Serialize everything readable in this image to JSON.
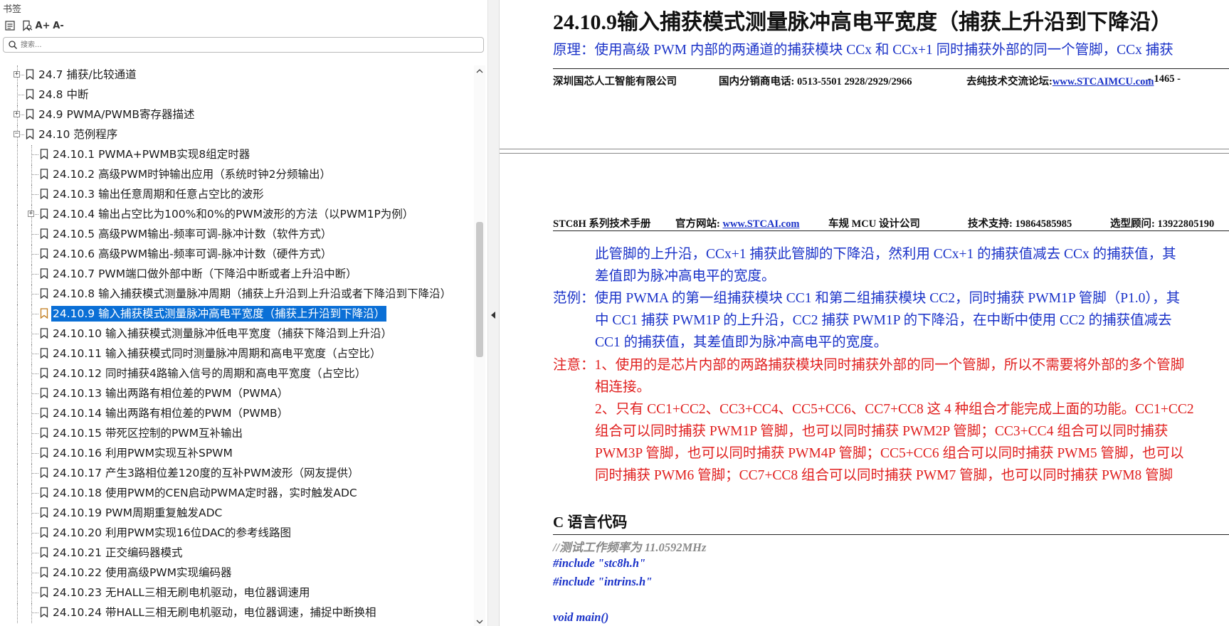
{
  "sidebar": {
    "title": "书签",
    "toolbar": {
      "btn1_icon": "list-icon",
      "btn2_icon": "bookmark-search-icon",
      "btn3_label": "A+",
      "btn4_label": "A-"
    },
    "search": {
      "placeholder": "搜索..."
    },
    "items": [
      {
        "label": "24.7 捕获/比较通道",
        "level": 1,
        "expandable": true,
        "expanded": false
      },
      {
        "label": "24.8 中断",
        "level": 1,
        "expandable": false
      },
      {
        "label": "24.9  PWMA/PWMB寄存器描述",
        "level": 1,
        "expandable": true,
        "expanded": false
      },
      {
        "label": "24.10  范例程序",
        "level": 1,
        "expandable": true,
        "expanded": true
      },
      {
        "label": "24.10.1 PWMA+PWMB实现8组定时器",
        "level": 2
      },
      {
        "label": "24.10.2 高级PWM时钟输出应用（系统时钟2分频输出）",
        "level": 2
      },
      {
        "label": "24.10.3 输出任意周期和任意占空比的波形",
        "level": 2
      },
      {
        "label": "24.10.4 输出占空比为100%和0%的PWM波形的方法（以PWM1P为例）",
        "level": 2,
        "expandable": true,
        "expanded": false
      },
      {
        "label": "24.10.5 高级PWM输出-频率可调-脉冲计数（软件方式）",
        "level": 2
      },
      {
        "label": "24.10.6 高级PWM输出-频率可调-脉冲计数（硬件方式）",
        "level": 2
      },
      {
        "label": "24.10.7 PWM端口做外部中断（下降沿中断或者上升沿中断）",
        "level": 2
      },
      {
        "label": "24.10.8 输入捕获模式测量脉冲周期（捕获上升沿到上升沿或者下降沿到下降沿）",
        "level": 2
      },
      {
        "label": "24.10.9 输入捕获模式测量脉冲高电平宽度（捕获上升沿到下降沿）",
        "level": 2,
        "selected": true
      },
      {
        "label": "24.10.10 输入捕获模式测量脉冲低电平宽度（捕获下降沿到上升沿）",
        "level": 2
      },
      {
        "label": "24.10.11 输入捕获模式同时测量脉冲周期和高电平宽度（占空比）",
        "level": 2
      },
      {
        "label": "24.10.12 同时捕获4路输入信号的周期和高电平宽度（占空比）",
        "level": 2
      },
      {
        "label": "24.10.13 输出两路有相位差的PWM（PWMA）",
        "level": 2
      },
      {
        "label": "24.10.14 输出两路有相位差的PWM（PWMB）",
        "level": 2
      },
      {
        "label": "24.10.15 带死区控制的PWM互补输出",
        "level": 2
      },
      {
        "label": "24.10.16 利用PWM实现互补SPWM",
        "level": 2
      },
      {
        "label": "24.10.17 产生3路相位差120度的互补PWM波形（网友提供）",
        "level": 2
      },
      {
        "label": "24.10.18 使用PWM的CEN启动PWMA定时器，实时触发ADC",
        "level": 2
      },
      {
        "label": "24.10.19 PWM周期重复触发ADC",
        "level": 2
      },
      {
        "label": "24.10.20 利用PWM实现16位DAC的参考线路图",
        "level": 2
      },
      {
        "label": "24.10.21 正交编码器模式",
        "level": 2
      },
      {
        "label": "24.10.22 使用高级PWM实现编码器",
        "level": 2
      },
      {
        "label": "24.10.23 无HALL三相无刷电机驱动，电位器调速用",
        "level": 2
      },
      {
        "label": "24.10.24 带HALL三相无刷电机驱动，电位器调速，捕捉中断换相",
        "level": 2
      }
    ]
  },
  "document": {
    "section_title": "24.10.9输入捕获模式测量脉冲高电平宽度（捕获上升沿到下降沿）",
    "principle_line": "原理：使用高级 PWM 内部的两通道的捕获模块 CCx 和 CCx+1 同时捕获外部的同一个管脚，CCx 捕获",
    "footer": {
      "company": "深圳国芯人工智能有限公司",
      "phone": "国内分销商电话: 0513-5501 2928/2929/2966",
      "forum_label": "去纯技术交流论坛:",
      "forum_link": "www.STCAIMCU.com",
      "page": "- 1465 -"
    },
    "header": {
      "manual": "STC8H 系列技术手册",
      "site_label": "官方网站: ",
      "site_link": "www.STCAI.com",
      "design": "车规 MCU 设计公司",
      "support": "技术支持: 19864585985",
      "consultant": "选型顾问: 13922805190"
    },
    "body_lines": [
      {
        "text": "此管脚的上升沿，CCx+1 捕获此管脚的下降沿，然利用 CCx+1 的捕获值减去 CCx 的捕获值，其",
        "color": "blue"
      },
      {
        "text": "差值即为脉冲高电平的宽度。",
        "color": "blue"
      },
      {
        "text": "范例：使用 PWMA 的第一组捕获模块 CC1 和第二组捕获模块 CC2，同时捕获 PWM1P 管脚（P1.0），其",
        "color": "blue"
      },
      {
        "text": "中 CC1 捕获 PWM1P 的上升沿，CC2 捕获 PWM1P 的下降沿，在中断中使用 CC2 的捕获值减去",
        "color": "blue"
      },
      {
        "text": "CC1 的捕获值，其差值即为脉冲高电平的宽度。",
        "color": "blue"
      },
      {
        "text": "注意：1、使用的是芯片内部的两路捕获模块同时捕获外部的同一个管脚，所以不需要将外部的多个管脚",
        "color": "red"
      },
      {
        "text": "相连接。",
        "color": "red"
      },
      {
        "text": "2、只有 CC1+CC2、CC3+CC4、CC5+CC6、CC7+CC8 这 4 种组合才能完成上面的功能。CC1+CC2",
        "color": "red"
      },
      {
        "text": "组合可以同时捕获 PWM1P 管脚，也可以同时捕获 PWM2P 管脚；CC3+CC4 组合可以同时捕获",
        "color": "red"
      },
      {
        "text": "PWM3P 管脚，也可以同时捕获 PWM4P 管脚；CC5+CC6 组合可以同时捕获 PWM5 管脚，也可以",
        "color": "red"
      },
      {
        "text": "同时捕获 PWM6 管脚；CC7+CC8 组合可以同时捕获 PWM7 管脚，也可以同时捕获 PWM8 管脚",
        "color": "red"
      }
    ],
    "c_heading": "C 语言代码",
    "code_lines": [
      {
        "text": "//测试工作频率为 11.0592MHz",
        "kind": "comment"
      },
      {
        "text": "#include \"stc8h.h\"",
        "kind": "code"
      },
      {
        "text": "#include \"intrins.h\"",
        "kind": "code"
      },
      {
        "text": "",
        "kind": "code"
      },
      {
        "text": "void main()",
        "kind": "code"
      }
    ]
  },
  "colors": {
    "selection": "#0a6fd6",
    "blue_text": "#1a32c8",
    "red_text": "#e0201f"
  }
}
